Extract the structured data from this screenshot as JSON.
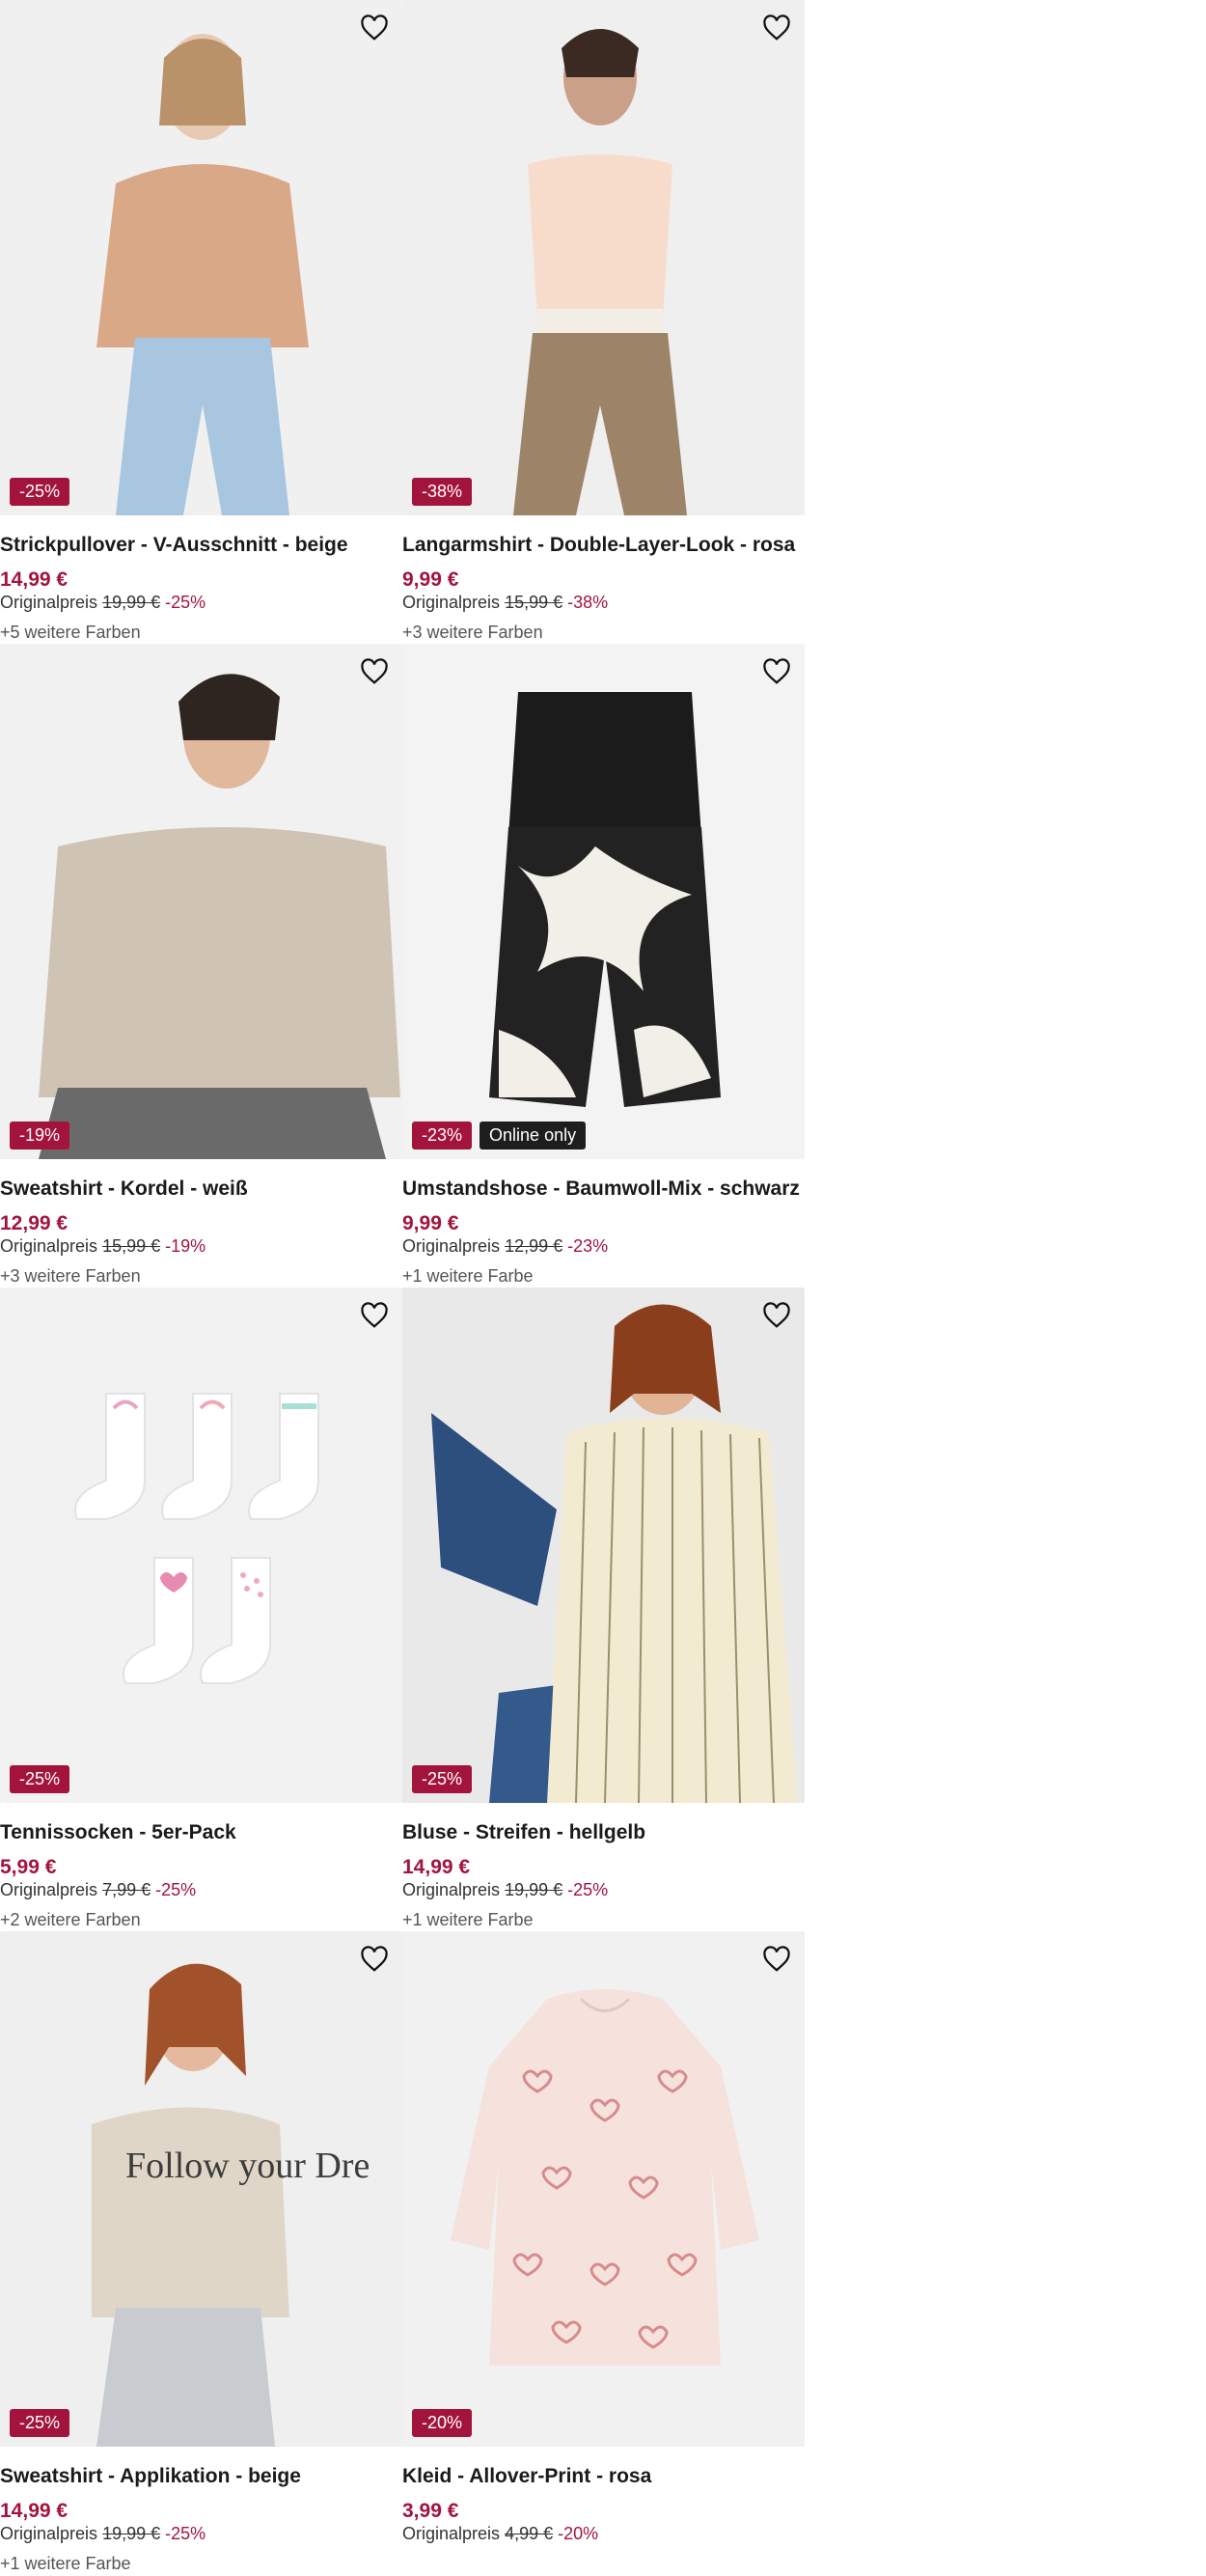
{
  "products": [
    {
      "title": "Strickpullover - V-Ausschnitt - beige",
      "price": "14,99 €",
      "orig_label": "Originalpreis",
      "orig_price": "19,99 €",
      "orig_pct": "-25%",
      "badge": "-25%",
      "colors": "+5 weitere Farben"
    },
    {
      "title": "Langarmshirt - Double-Layer-Look - rosa",
      "price": "9,99 €",
      "orig_label": "Originalpreis",
      "orig_price": "15,99 €",
      "orig_pct": "-38%",
      "badge": "-38%",
      "colors": "+3 weitere Farben"
    },
    {
      "title": "Sweatshirt - Kordel - weiß",
      "price": "12,99 €",
      "orig_label": "Originalpreis",
      "orig_price": "15,99 €",
      "orig_pct": "-19%",
      "badge": "-19%",
      "colors": "+3 weitere Farben"
    },
    {
      "title": "Umstandshose - Baumwoll-Mix - schwarz",
      "price": "9,99 €",
      "orig_label": "Originalpreis",
      "orig_price": "12,99 €",
      "orig_pct": "-23%",
      "badge": "-23%",
      "badge2": "Online only",
      "colors": "+1 weitere Farbe"
    },
    {
      "title": "Tennissocken - 5er-Pack",
      "price": "5,99 €",
      "orig_label": "Originalpreis",
      "orig_price": "7,99 €",
      "orig_pct": "-25%",
      "badge": "-25%",
      "colors": "+2 weitere Farben"
    },
    {
      "title": "Bluse - Streifen - hellgelb",
      "price": "14,99 €",
      "orig_label": "Originalpreis",
      "orig_price": "19,99 €",
      "orig_pct": "-25%",
      "badge": "-25%",
      "colors": "+1 weitere Farbe"
    },
    {
      "title": "Sweatshirt - Applikation - beige",
      "price": "14,99 €",
      "orig_label": "Originalpreis",
      "orig_price": "19,99 €",
      "orig_pct": "-25%",
      "badge": "-25%",
      "colors": "+1 weitere Farbe",
      "print_text": "Follow your Dre"
    },
    {
      "title": "Kleid - Allover-Print - rosa",
      "price": "3,99 €",
      "orig_label": "Originalpreis",
      "orig_price": "4,99 €",
      "orig_pct": "-20%",
      "badge": "-20%",
      "colors": ""
    }
  ],
  "icons": {
    "favorite": "heart-outline-icon"
  },
  "colors": {
    "sale": "#a3143c",
    "online_badge": "#1e1e1e",
    "image_bg": "#efefef"
  }
}
